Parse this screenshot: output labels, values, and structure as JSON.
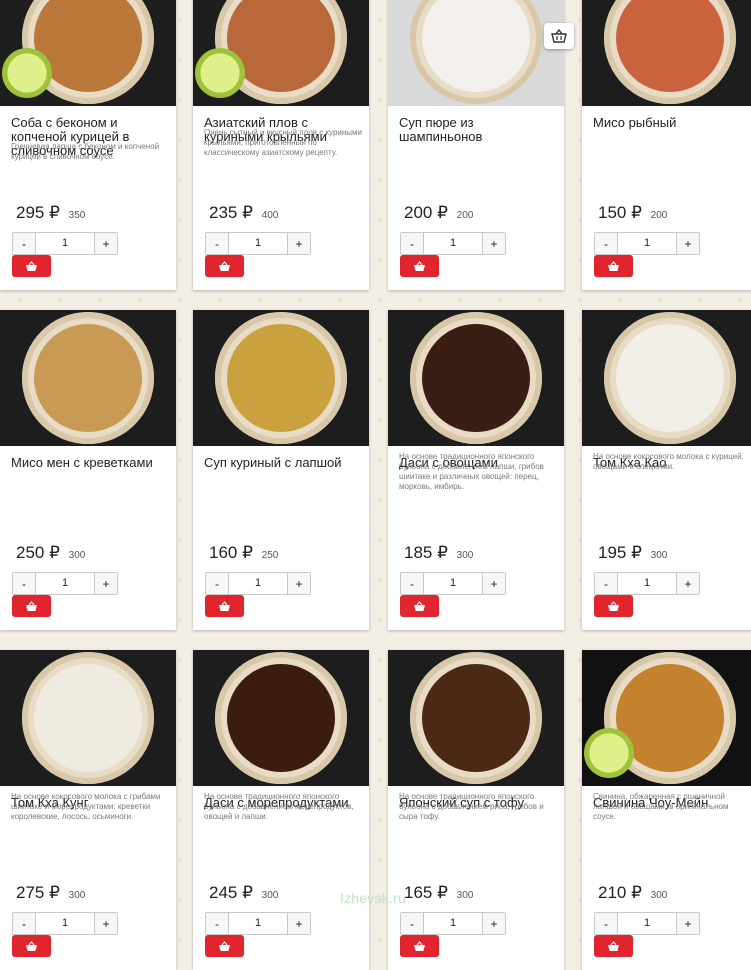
{
  "currency": "₽",
  "qty_minus": "-",
  "qty_plus": "+",
  "watermark": "Izhevsk.ru",
  "products": [
    {
      "title": "Соба с беконом и копченой курицей в сливочном соусе",
      "desc": "Гречневая лапша с беконом и копченой курицей в сливочном соусе.",
      "price": "295",
      "old_price": "350",
      "qty": "1"
    },
    {
      "title": "Азиатский плов с куриными крыльями",
      "desc": "Очень сытный и вкусный плов с куриными крыльями, приготовленный по классическому азиатскому рецепту.",
      "price": "235",
      "old_price": "400",
      "qty": "1"
    },
    {
      "title": "Суп пюре из шампиньонов",
      "desc": "",
      "price": "200",
      "old_price": "200",
      "qty": "1"
    },
    {
      "title": "Мисо рыбный",
      "desc": "",
      "price": "150",
      "old_price": "200",
      "qty": "1"
    },
    {
      "title": "Мисо мен с креветками",
      "desc": "",
      "price": "250",
      "old_price": "300",
      "qty": "1"
    },
    {
      "title": "Суп куриный с лапшой",
      "desc": "",
      "price": "160",
      "old_price": "250",
      "qty": "1"
    },
    {
      "title": "Даси с овощами",
      "desc": "На основе традиционного японского бульона с добавлением лапши, грибов шиитаке и различных овощей: перец, морковь, имбирь.",
      "price": "185",
      "old_price": "300",
      "qty": "1"
    },
    {
      "title": "Том Кха Као",
      "desc": "На основе кокосового молока с курицей, овощами и специями.",
      "price": "195",
      "old_price": "300",
      "qty": "1"
    },
    {
      "title": "Том Кха Кунг",
      "desc": "На основе кокосового молока с грибами шиитаке и морепродуктами: креветки королевские, лосось, осьминоги.",
      "price": "275",
      "old_price": "300",
      "qty": "1"
    },
    {
      "title": "Даси с морепродуктами",
      "desc": "На основе традиционного японского бульона с добавлением морепродуктов, овощей и лапши.",
      "price": "245",
      "old_price": "300",
      "qty": "1"
    },
    {
      "title": "Японский суп с тофу",
      "desc": "На основе традиционного японского бульона с добавлением риса, грибов и сыра тофу.",
      "price": "165",
      "old_price": "300",
      "qty": "1"
    },
    {
      "title": "Свинина Чоу-Мейн",
      "desc": "Свинина, обжаренная с пшеничной лапшой и овощами, в оригинальном соусе.",
      "price": "210",
      "old_price": "300",
      "qty": "1"
    }
  ]
}
